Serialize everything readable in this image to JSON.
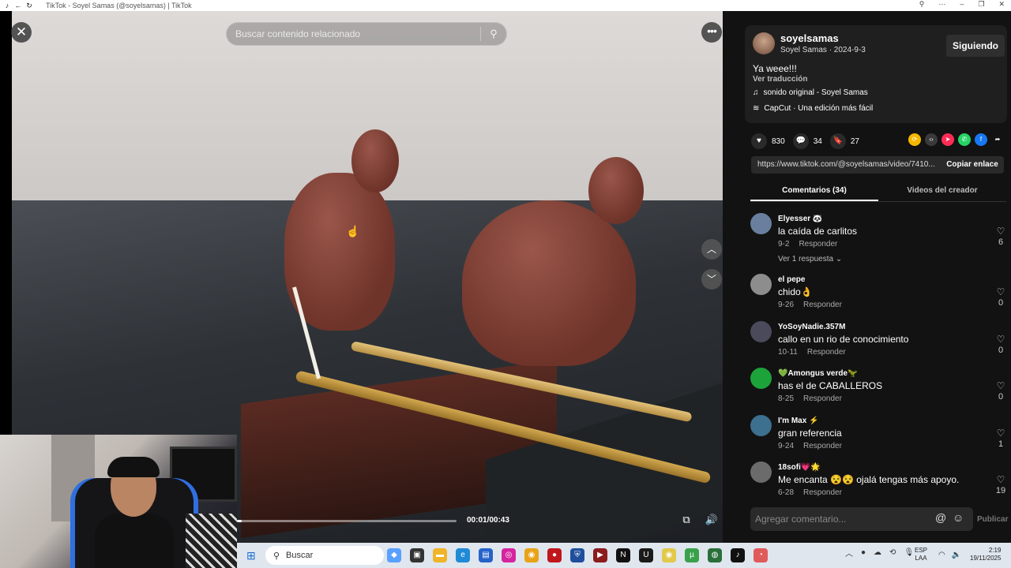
{
  "window": {
    "title": "TikTok - Soyel Samas (@soyelsamas) | TikTok"
  },
  "player": {
    "search_placeholder": "Buscar contenido relacionado",
    "time": "00:01/00:43",
    "progress": 0.02
  },
  "post": {
    "username": "soyelsamas",
    "subline": "Soyel Samas · 2024-9-3",
    "follow_label": "Siguiendo",
    "caption": "Ya weee!!!",
    "translate_label": "Ver traducción",
    "music": "sonido original - Soyel Samas",
    "capcut": "CapCut · Una edición más fácil",
    "likes": "830",
    "comments_count": "34",
    "saves": "27",
    "link": "https://www.tiktok.com/@soyelsamas/video/7410...",
    "copy_label": "Copiar enlace"
  },
  "tabs": [
    "Comentarios (34)",
    "Videos del creador"
  ],
  "comments": [
    {
      "name": "Elyesser 🐼",
      "text": "la caída de carlitos",
      "date": "9-2",
      "reply": "Responder",
      "likes": "6",
      "more": "Ver 1 respuesta ⌄",
      "color": "#6a7f9e"
    },
    {
      "name": "el pepe",
      "text": "chido👌",
      "date": "9-26",
      "reply": "Responder",
      "likes": "0",
      "color": "#8d8d8d"
    },
    {
      "name": "YoSoyNadie.357M",
      "text": "callo en un rio de conocimiento",
      "date": "10-11",
      "reply": "Responder",
      "likes": "0",
      "color": "#4a4a5a"
    },
    {
      "name": "💚Amongus verde🦖",
      "text": "has el de CABALLEROS",
      "date": "8-25",
      "reply": "Responder",
      "likes": "0",
      "color": "#1ca33a"
    },
    {
      "name": "I'm    Max ⚡",
      "text": "gran referencia",
      "date": "9-24",
      "reply": "Responder",
      "likes": "1",
      "color": "#3d6f8f"
    },
    {
      "name": "18sofi💗🌟",
      "text": "Me encanta 😵😵 ojalá tengas más apoyo.",
      "date": "6-28",
      "reply": "Responder",
      "likes": "19",
      "color": "#6b6b6b"
    }
  ],
  "composer": {
    "placeholder": "Agregar comentario...",
    "publish": "Publicar"
  },
  "taskbar": {
    "search_label": "Buscar",
    "lang_top": "ESP",
    "lang_bottom": "LAA",
    "time": "2:19",
    "date": "19/11/2025"
  }
}
